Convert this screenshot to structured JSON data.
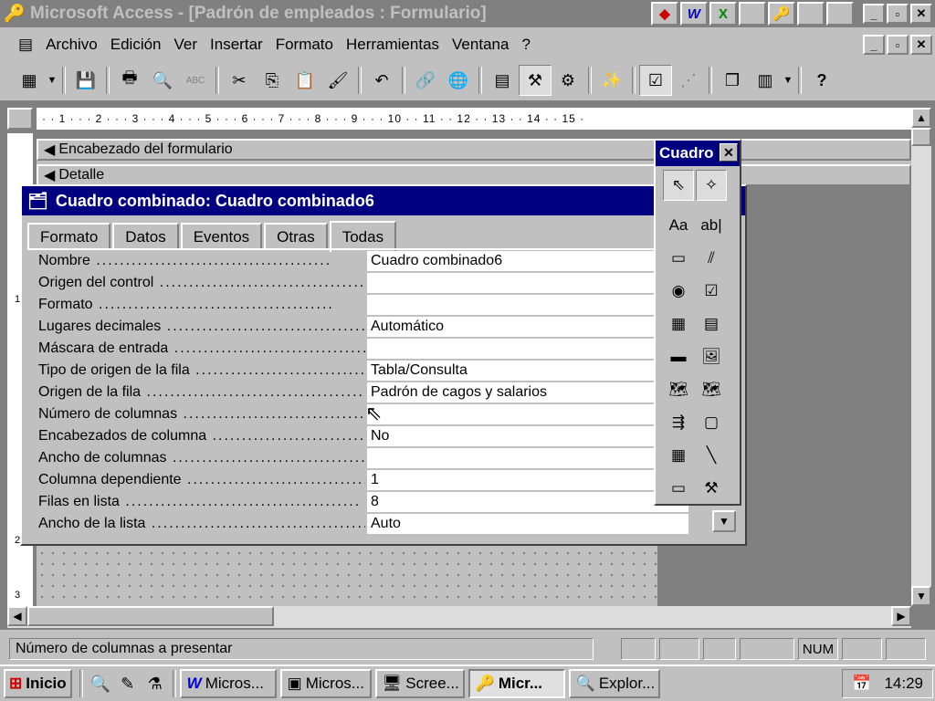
{
  "window": {
    "title": "Microsoft Access - [Padrón de empleados : Formulario]",
    "quicklaunch": [
      "W",
      "X",
      "▣",
      "🔑",
      "✎",
      "⚗"
    ],
    "min": "_",
    "max": "▫",
    "close": "✕"
  },
  "menubar": {
    "items": [
      "Archivo",
      "Edición",
      "Ver",
      "Insertar",
      "Formato",
      "Herramientas",
      "Ventana",
      "?"
    ]
  },
  "toolbar": {
    "buttons": [
      "▦",
      "💾",
      "🖶",
      "🔍",
      "ABC",
      "✂",
      "⎘",
      "📋",
      "🖌",
      "↶",
      "🔗",
      "🌐",
      "▤",
      "⚒",
      "⚙",
      "✨",
      "☑",
      "⋰",
      "❐",
      "▥",
      "?"
    ]
  },
  "form_design": {
    "ruler_text": "· · 1 · · · 2 · · · 3 · · · 4 · · · 5 · · · 6 · · · 7 · · · 8 · · · 9 · · · 10 · · 11 · · 12 · · 13 · · 14 · · 15 ·",
    "sections": [
      "Encabezado del formulario",
      "Detalle"
    ],
    "vruler": [
      "1",
      "2",
      "3"
    ]
  },
  "properties": {
    "title": "Cuadro combinado: Cuadro combinado6",
    "tabs": [
      "Formato",
      "Datos",
      "Eventos",
      "Otras",
      "Todas"
    ],
    "selected_tab": "Todas",
    "rows": [
      {
        "label": "Nombre",
        "value": "Cuadro combinado6"
      },
      {
        "label": "Origen del control",
        "value": ""
      },
      {
        "label": "Formato",
        "value": ""
      },
      {
        "label": "Lugares decimales",
        "value": "Automático"
      },
      {
        "label": "Máscara de entrada",
        "value": ""
      },
      {
        "label": "Tipo de origen de la fila",
        "value": "Tabla/Consulta"
      },
      {
        "label": "Origen de la fila",
        "value": "Padrón de cagos y salarios"
      },
      {
        "label": "Número de columnas",
        "value": ""
      },
      {
        "label": "Encabezados de columna",
        "value": "No"
      },
      {
        "label": "Ancho de columnas",
        "value": ""
      },
      {
        "label": "Columna dependiente",
        "value": "1"
      },
      {
        "label": "Filas en lista",
        "value": "8"
      },
      {
        "label": "Ancho de la lista",
        "value": "Auto"
      }
    ]
  },
  "toolbox": {
    "title": "Cuadro",
    "close": "✕",
    "tools": [
      "⇖",
      "✧",
      "Aa",
      "ab|",
      "▭",
      "⫽",
      "◉",
      "☑",
      "▦",
      "▤",
      "▬",
      "🖼",
      "🗺",
      "🗺",
      "⇶",
      "▢",
      "▦",
      "╲",
      "▭",
      "⚒"
    ]
  },
  "statusbar": {
    "message": "Número de columnas a presentar",
    "num": "NUM"
  },
  "taskbar": {
    "start": "Inicio",
    "quick": [
      "🔍",
      "✎",
      "⚗"
    ],
    "tasks": [
      "Micros...",
      "Micros...",
      "Scree...",
      "Micr...",
      "Explor..."
    ],
    "time": "14:29"
  }
}
